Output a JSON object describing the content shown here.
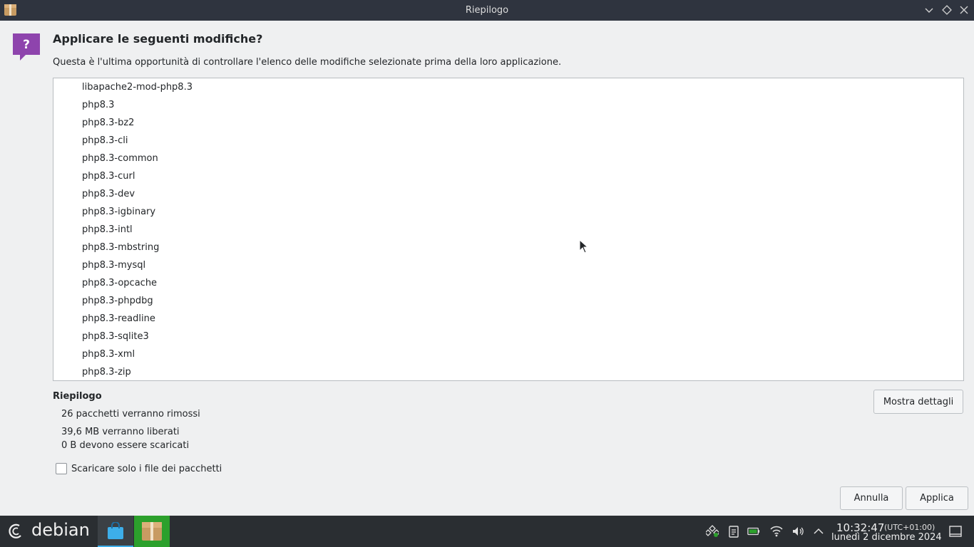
{
  "window": {
    "title": "Riepilogo",
    "controls": [
      "chevron-down-icon",
      "diamond-icon",
      "close-icon"
    ]
  },
  "dialog": {
    "heading": "Applicare le seguenti modifiche?",
    "description": "Questa è l'ultima opportunità di controllare l'elenco delle modifiche selezionate prima della loro applicazione.",
    "packages": [
      "libapache2-mod-php8.3",
      "php8.3",
      "php8.3-bz2",
      "php8.3-cli",
      "php8.3-common",
      "php8.3-curl",
      "php8.3-dev",
      "php8.3-igbinary",
      "php8.3-intl",
      "php8.3-mbstring",
      "php8.3-mysql",
      "php8.3-opcache",
      "php8.3-phpdbg",
      "php8.3-readline",
      "php8.3-sqlite3",
      "php8.3-xml",
      "php8.3-zip"
    ],
    "summary": {
      "title": "Riepilogo",
      "removed": "26 pacchetti verranno rimossi",
      "freed": "39,6 MB verranno liberati",
      "download": "0  B devono essere scaricati"
    },
    "show_details_label": "Mostra dettagli",
    "download_only_label": "Scaricare solo i file dei pacchetti",
    "download_only_checked": false,
    "cancel_label": "Annulla",
    "apply_label": "Applica"
  },
  "taskbar": {
    "logo_text": "debian",
    "clock_time": "10:32:47",
    "clock_tz": "(UTC+01:00)",
    "clock_date": "lunedì 2 dicembre 2024"
  },
  "colors": {
    "titlebar": "#2f343f",
    "taskbar": "#2a2e32",
    "accent_purple": "#8e44ad",
    "active_task": "#3daee9",
    "package_task": "#2ca02c"
  }
}
